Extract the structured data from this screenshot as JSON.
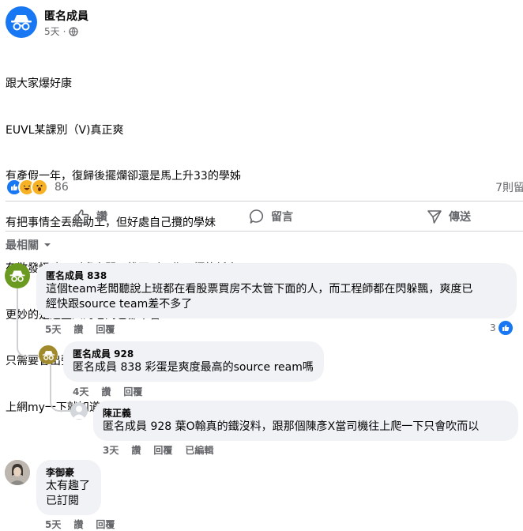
{
  "post": {
    "author": "匿名成員",
    "time": "5天",
    "audience_icon": "globe-icon",
    "lines": [
      "跟大家爆好康",
      "EUVL某課別（V)真正爽",
      "有產假一年，復歸後擺爛卻還是馬上升33的學姊",
      "有把事情全丟給助工，但好處自己攬的學妹",
      "有散發怪味，到處串門子找不到工作目標的新人",
      "更妙的是這些人的老闆也都不管",
      "只需要會出張嘴叫艾斯貓貓分析，再整裡去報告",
      "上網my一下就知道，有興趣的可以去談JOS"
    ],
    "reaction_count": "86",
    "comment_count": "7則留",
    "actions": {
      "like": "讚",
      "comment": "留言",
      "share": "傳送"
    }
  },
  "sort_label": "最相關",
  "comments": [
    {
      "author": "匿名成員 838",
      "text_line1": "這個team老闆聽說上班都在看股票買房不太管下面的人，而工程師都在閃躲飄，爽度已",
      "text_line2": "經快跟source team差不多了",
      "time": "5天",
      "like": "讚",
      "reply": "回覆",
      "likes": "3"
    },
    {
      "author": "匿名成員 928",
      "text": "匿名成員 838 彩蛋是爽度最高的source ream嗎",
      "time": "4天",
      "like": "讚",
      "reply": "回覆"
    },
    {
      "author": "陳正義",
      "text": "匿名成員 928 葉O翰真的鐵沒料，跟那個陳彥X當司機往上爬一下只會吹而以",
      "time": "3天",
      "like": "讚",
      "reply": "回覆",
      "edited": "已編輯"
    },
    {
      "author": "李御豪",
      "text_line1": "太有趣了",
      "text_line2": "已訂閱",
      "time": "5天",
      "like": "讚",
      "reply": "回覆"
    }
  ],
  "colors": {
    "accent": "#1877f2",
    "muted": "#65676b",
    "bubble": "#f0f2f5",
    "green_avatar": "#6a9a1f",
    "gold_avatar": "#a08a2c"
  }
}
